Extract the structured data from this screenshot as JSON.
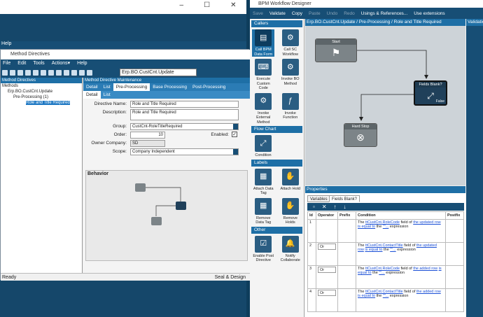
{
  "bg_window": {
    "menu": "Help",
    "controls": [
      "–",
      "☐",
      "✕"
    ]
  },
  "method_directives": {
    "title": "Method Directives",
    "menu": [
      "File",
      "Edit",
      "Tools",
      "Actions▾",
      "Help"
    ],
    "method_combo": "Erp.BO.CustCnt.Update",
    "tree_header": "Method Directives",
    "tree": [
      "Methods",
      "Erp.BO.CustCnt.Update",
      "Pre-Processing (1)",
      "Role and Title Required"
    ],
    "detail_header": "Method Directive Maintenance",
    "tabs": [
      "Detail",
      "List",
      "Pre-Processing",
      "Base Processing",
      "Post-Processing"
    ],
    "subtabs": [
      "Detail",
      "List"
    ],
    "form": {
      "directive_name_label": "Directive Name:",
      "directive_name": "Role and Title Required",
      "description_label": "Description:",
      "description": "Role and Title Required",
      "group_label": "Group:",
      "group": "CustCnt-RoleTitleRequired",
      "order_label": "Order:",
      "order": "10",
      "enabled_label": "Enabled:",
      "owner_label": "Owner Company:",
      "owner": "SD",
      "scope_label": "Scope:",
      "scope": "Company Independent"
    },
    "behavior_label": "Behavior",
    "mini_nodes": [
      "Start",
      "Fields Blank?",
      "Hard Stop"
    ],
    "status_left": "Ready",
    "status_right": "Seal & Design"
  },
  "bpm": {
    "title": "BPM Workflow Designer",
    "toolbar": [
      "Save",
      "Validate",
      "Copy",
      "Paste",
      "Undo",
      "Redo",
      "Usings & References...",
      "Use extensions"
    ],
    "palette": {
      "callers_header": "Callers",
      "callers": [
        "Call BPM Data Form",
        "Call SC Workflow",
        "Execute Custom Code",
        "Invoke BO Method",
        "Invoke External Method",
        "Invoke Function"
      ],
      "flowchart_header": "Flow Chart",
      "flowchart": [
        "Condition"
      ],
      "labels_header": "Labels",
      "labels": [
        "Attach Data Tag",
        "Attach Hold",
        "Remove Data Tag",
        "Remove Holds"
      ],
      "other_header": "Other",
      "other": [
        "Enable Post Directive",
        "Notify Collaborate"
      ]
    },
    "canvas_header": "Erp.BO.CustCnt.Update / Pre-Processing / Role and Title Required",
    "nodes": {
      "start": "Start",
      "fields_blank": "Fields Blank?",
      "false_label": "False",
      "hard_stop": "Hard Stop"
    },
    "validation_header": "Validation",
    "properties_header": "Properties",
    "prop_tabs": [
      "Variables",
      "Fields Blank?"
    ],
    "grid_headers": [
      "Id",
      "Operator",
      "Prefix",
      "Condition",
      "Postfix"
    ],
    "rows": [
      {
        "id": "1",
        "op": "",
        "c1": "The ",
        "field": "ttCustCnt.RoleCode",
        "c2": " field of ",
        "row": "the updated row",
        "c3": " ",
        "eq": "is equal to",
        "c4": " the ",
        "expr": "\"\"...",
        "c5": " expression"
      },
      {
        "id": "2",
        "op": "Or",
        "c1": "The ",
        "field": "ttCustCnt.ContactTitle",
        "c2": " field of ",
        "row": "the updated row",
        "c3": " ",
        "eq": "is equal to",
        "c4": " the ",
        "expr": "\"\"...",
        "c5": " expression"
      },
      {
        "id": "3",
        "op": "Or",
        "c1": "The ",
        "field": "ttCustCnt.RoleCode",
        "c2": " field of ",
        "row": "the added row",
        "c3": " ",
        "eq": "is equal to",
        "c4": " the ",
        "expr": "\"\"...",
        "c5": " expression"
      },
      {
        "id": "4",
        "op": "Or",
        "c1": "The ",
        "field": "ttCustCnt.ContactTitle",
        "c2": " field of ",
        "row": "the added row",
        "c3": " ",
        "eq": "is equal to",
        "c4": " the ",
        "expr": "\"\"...",
        "c5": " expression"
      }
    ]
  }
}
